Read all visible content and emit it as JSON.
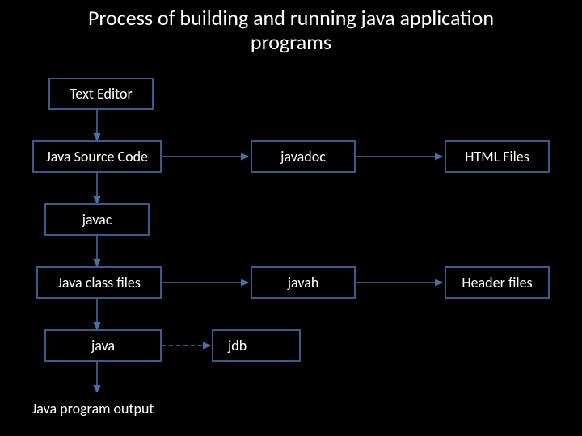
{
  "title": "Process of building and running java application programs",
  "nodes": {
    "text_editor": "Text Editor",
    "java_source": "Java Source Code",
    "javadoc": "javadoc",
    "html_files": "HTML Files",
    "javac": "javac",
    "class_files": "Java class files",
    "javah": "javah",
    "header_files": "Header files",
    "java_runtime": "java",
    "jdb": "jdb",
    "output": "Java program output"
  },
  "edges": [
    {
      "from": "text_editor",
      "to": "java_source",
      "style": "solid"
    },
    {
      "from": "java_source",
      "to": "javadoc",
      "style": "solid"
    },
    {
      "from": "javadoc",
      "to": "html_files",
      "style": "solid"
    },
    {
      "from": "java_source",
      "to": "javac",
      "style": "solid"
    },
    {
      "from": "javac",
      "to": "class_files",
      "style": "solid"
    },
    {
      "from": "class_files",
      "to": "javah",
      "style": "solid"
    },
    {
      "from": "javah",
      "to": "header_files",
      "style": "solid"
    },
    {
      "from": "class_files",
      "to": "java_runtime",
      "style": "solid"
    },
    {
      "from": "java_runtime",
      "to": "jdb",
      "style": "dashed"
    },
    {
      "from": "java_runtime",
      "to": "output",
      "style": "solid"
    }
  ]
}
